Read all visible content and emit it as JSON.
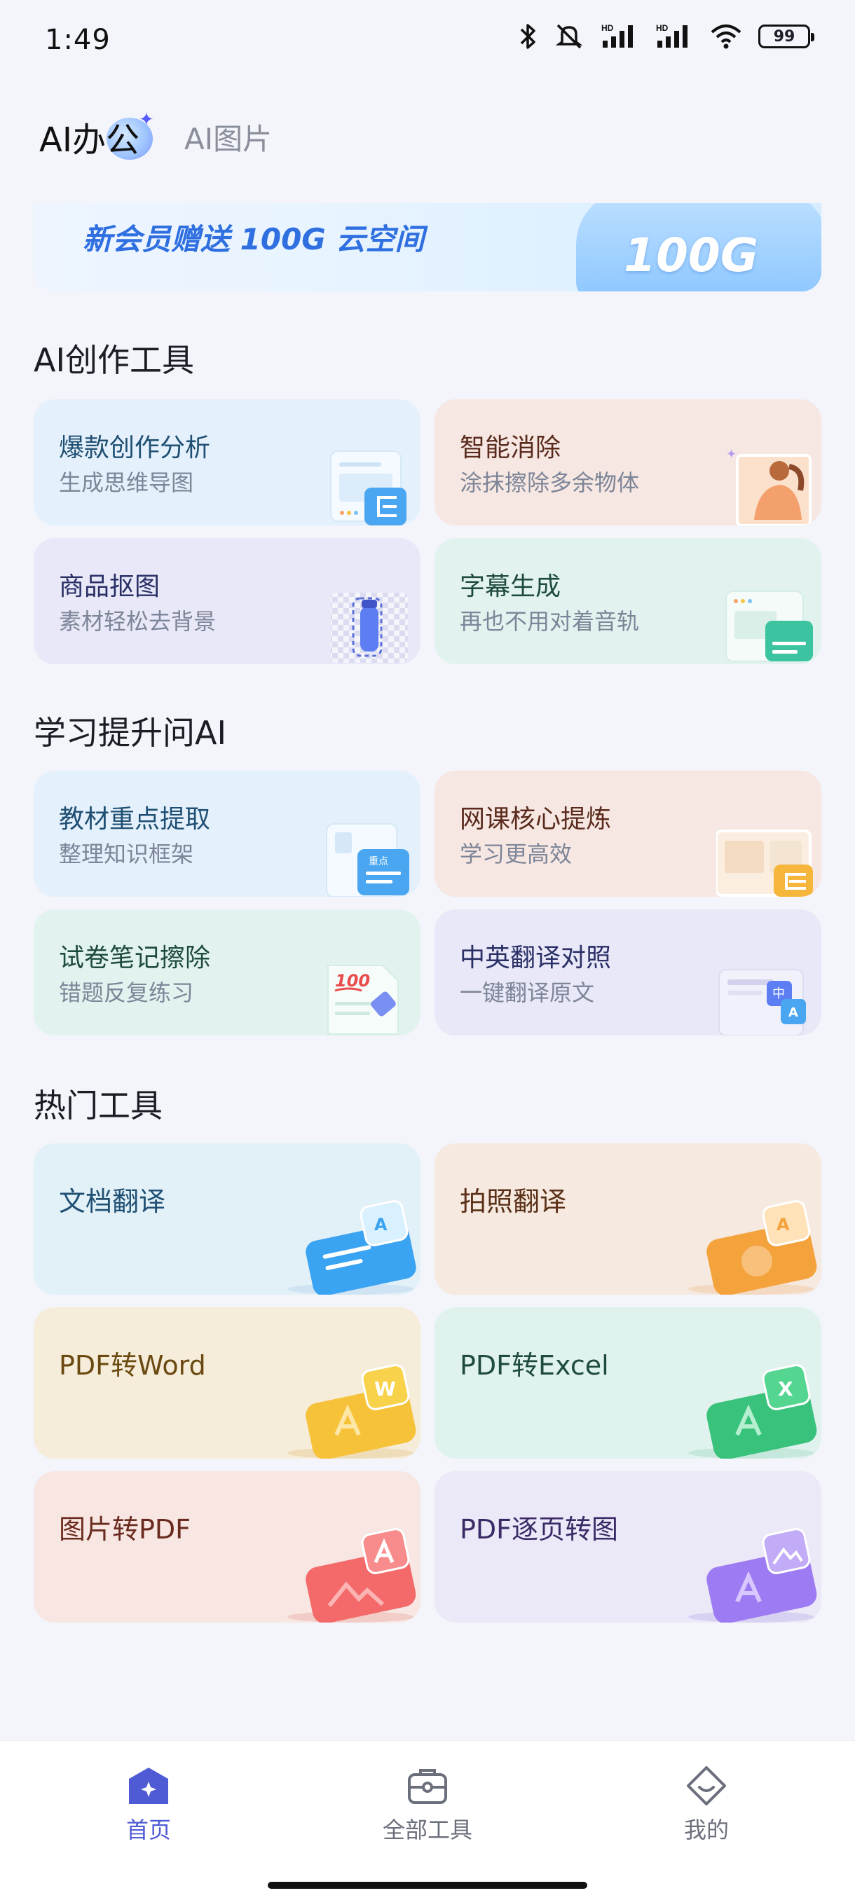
{
  "status_bar": {
    "time": "1:49",
    "battery": "99",
    "signal_labels": [
      "HD",
      "HD"
    ]
  },
  "top_tabs": {
    "active": "AI办公",
    "inactive": "AI图片"
  },
  "banner": {
    "text": "新会员赠送 100G 云空间",
    "badge": "100G"
  },
  "sections": {
    "ai_creation": {
      "title": "AI创作工具",
      "cards": [
        {
          "title": "爆款创作分析",
          "subtitle": "生成思维导图",
          "bg": "#e4f0fb",
          "title_color": "#1f4f73"
        },
        {
          "title": "智能消除",
          "subtitle": "涂抹擦除多余物体",
          "bg": "#f6e7e2",
          "title_color": "#5a2b1d"
        },
        {
          "title": "商品抠图",
          "subtitle": "素材轻松去背景",
          "bg": "#e8e8f8",
          "title_color": "#2a2f66"
        },
        {
          "title": "字幕生成",
          "subtitle": "再也不用对着音轨",
          "bg": "#e2f3ef",
          "title_color": "#1f4a40"
        }
      ]
    },
    "study": {
      "title": "学习提升问AI",
      "cards": [
        {
          "title": "教材重点提取",
          "subtitle": "整理知识框架",
          "bg": "#e4f0fb",
          "title_color": "#1f4f73",
          "badge": "重点"
        },
        {
          "title": "网课核心提炼",
          "subtitle": "学习更高效",
          "bg": "#f6e7e2",
          "title_color": "#5a2b1d"
        },
        {
          "title": "试卷笔记擦除",
          "subtitle": "错题反复练习",
          "bg": "#e2f3ef",
          "title_color": "#1f4a40",
          "badge": "100"
        },
        {
          "title": "中英翻译对照",
          "subtitle": "一键翻译原文",
          "bg": "#e8e8f8",
          "title_color": "#2a2f66",
          "badge": "中"
        }
      ]
    },
    "hot_tools": {
      "title": "热门工具",
      "cards": [
        {
          "title": "文档翻译",
          "bg": "#e2f0f8",
          "title_color": "#1f4f73",
          "accent": "#3aa3f2"
        },
        {
          "title": "拍照翻译",
          "bg": "#f6e9df",
          "title_color": "#5a3018",
          "accent": "#f4a23c"
        },
        {
          "title": "PDF转Word",
          "bg": "#f6ecda",
          "title_color": "#6a4a10",
          "accent": "#f6c23a"
        },
        {
          "title": "PDF转Excel",
          "bg": "#e0f2ee",
          "title_color": "#1f4a40",
          "accent": "#38c27b"
        },
        {
          "title": "图片转PDF",
          "bg": "#f7e6e2",
          "title_color": "#6a2a1e",
          "accent": "#f46a6a"
        },
        {
          "title": "PDF逐页转图",
          "bg": "#ebe8f8",
          "title_color": "#3a2a66",
          "accent": "#9d7bf2"
        }
      ]
    }
  },
  "bottom_nav": {
    "items": [
      {
        "label": "首页",
        "icon": "home-icon",
        "active": true
      },
      {
        "label": "全部工具",
        "icon": "toolbox-icon",
        "active": false
      },
      {
        "label": "我的",
        "icon": "profile-icon",
        "active": false
      }
    ]
  },
  "colors": {
    "accent": "#4f5bd5",
    "background": "#f3f5fb"
  }
}
